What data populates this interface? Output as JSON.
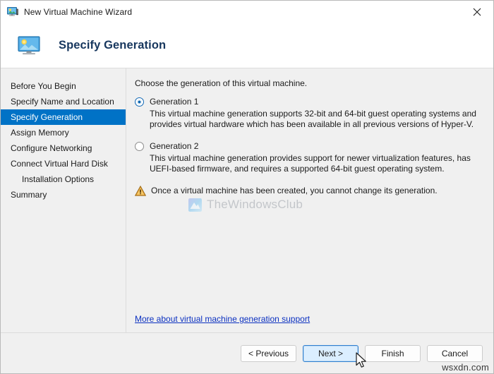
{
  "window": {
    "title": "New Virtual Machine Wizard",
    "title_icon": "virtual-machine-monitor-icon",
    "close_icon": "close-icon"
  },
  "header": {
    "icon": "virtual-machine-monitor-icon",
    "title": "Specify Generation"
  },
  "sidebar": {
    "items": [
      {
        "label": "Before You Begin",
        "selected": false,
        "indent": false
      },
      {
        "label": "Specify Name and Location",
        "selected": false,
        "indent": false
      },
      {
        "label": "Specify Generation",
        "selected": true,
        "indent": false
      },
      {
        "label": "Assign Memory",
        "selected": false,
        "indent": false
      },
      {
        "label": "Configure Networking",
        "selected": false,
        "indent": false
      },
      {
        "label": "Connect Virtual Hard Disk",
        "selected": false,
        "indent": false
      },
      {
        "label": "Installation Options",
        "selected": false,
        "indent": true
      },
      {
        "label": "Summary",
        "selected": false,
        "indent": false
      }
    ]
  },
  "main": {
    "intro": "Choose the generation of this virtual machine.",
    "options": [
      {
        "label": "Generation 1",
        "selected": true,
        "description": "This virtual machine generation supports 32-bit and 64-bit guest operating systems and provides virtual hardware which has been available in all previous versions of Hyper-V."
      },
      {
        "label": "Generation 2",
        "selected": false,
        "description": "This virtual machine generation provides support for newer virtualization features, has UEFI-based firmware, and requires a supported 64-bit guest operating system."
      }
    ],
    "warning": {
      "icon": "warning-triangle-icon",
      "text": "Once a virtual machine has been created, you cannot change its generation."
    },
    "link": "More about virtual machine generation support"
  },
  "watermark": {
    "logo_icon": "thewindowsclub-logo-icon",
    "text": "TheWindowsClub"
  },
  "footer": {
    "buttons": [
      {
        "label": "< Previous",
        "default": false
      },
      {
        "label": "Next >",
        "default": true
      },
      {
        "label": "Finish",
        "default": false
      },
      {
        "label": "Cancel",
        "default": false
      }
    ],
    "watermark": "wsxdn.com"
  },
  "colors": {
    "accent": "#0072c6",
    "header_title": "#17375e",
    "link": "#0b30c0",
    "warning": "#e8a33d",
    "window_bg": "#f0f0f0"
  }
}
